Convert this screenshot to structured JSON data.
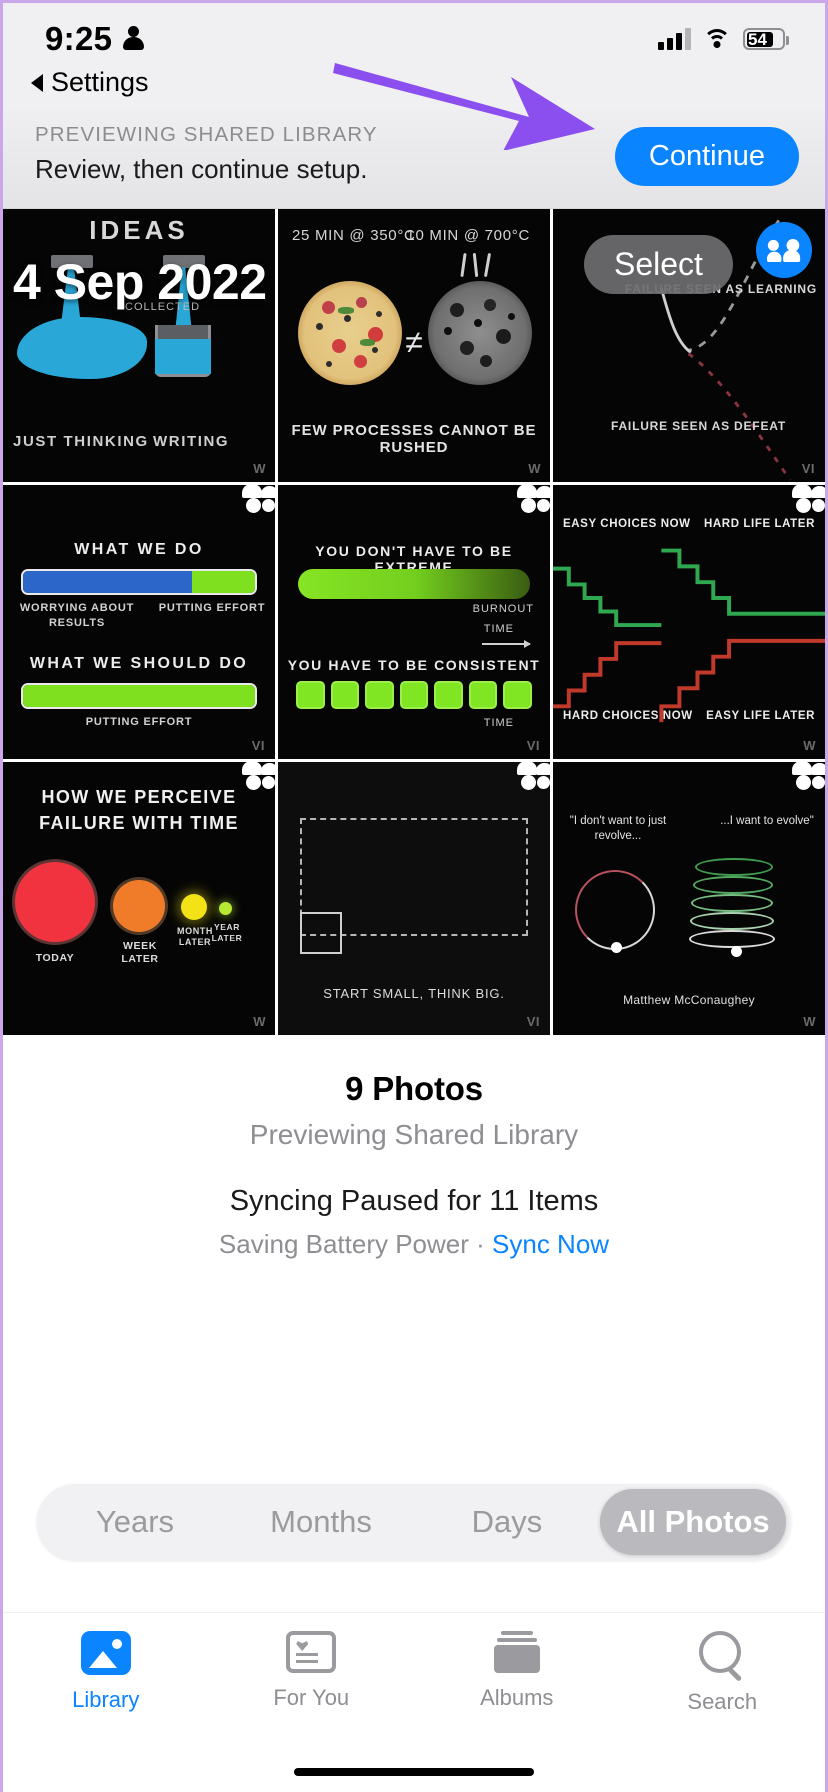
{
  "status_bar": {
    "time": "9:25",
    "person_icon": "person-icon",
    "signal_icon": "cellular-signal-icon",
    "wifi_icon": "wifi-icon",
    "battery_level": "54",
    "battery_icon": "battery-icon"
  },
  "nav": {
    "back_label": "Settings",
    "back_icon": "chevron-left-icon"
  },
  "banner": {
    "kicker": "PREVIEWING SHARED LIBRARY",
    "subtitle": "Review, then continue setup.",
    "continue_label": "Continue",
    "accent_color": "#0a84ff",
    "annotation_arrow_color": "#8b4ff0"
  },
  "grid": {
    "select_label": "Select",
    "date_overlay": "4 Sep 2022",
    "photos": [
      {
        "name": "ideas-thinking-vs-writing",
        "title": "IDEAS",
        "label_left": "JUST THINKING",
        "label_right": "WRITING",
        "annotation": "COLLECTED",
        "watermark": "W",
        "shared": false
      },
      {
        "name": "pizza-processes",
        "label_left": "25 MIN @ 350°C",
        "label_right": "10 MIN @ 700°C",
        "operator": "≠",
        "caption": "FEW PROCESSES CANNOT BE RUSHED",
        "watermark": "W",
        "shared": false
      },
      {
        "name": "failure-seen-as",
        "label_right": "FAILURE SEEN AS LEARNING",
        "label_bottom": "FAILURE SEEN AS DEFEAT",
        "watermark": "VI",
        "shared": true,
        "badge_style": "blue-circle"
      },
      {
        "name": "what-we-do-effort",
        "heading_top": "WHAT WE DO",
        "label_left": "WORRYING ABOUT RESULTS",
        "label_right": "PUTTING EFFORT",
        "heading_bottom": "WHAT WE SHOULD DO",
        "label_bottom": "PUTTING EFFORT",
        "watermark": "VI",
        "shared": true
      },
      {
        "name": "be-consistent-not-extreme",
        "heading_top": "YOU DON'T HAVE TO BE EXTREME",
        "label_burnout": "BURNOUT",
        "label_time": "TIME",
        "heading_bottom": "YOU HAVE TO BE CONSISTENT",
        "label_time2": "TIME",
        "watermark": "VI",
        "shared": true
      },
      {
        "name": "easy-hard-choices",
        "label_tl": "EASY CHOICES NOW",
        "label_tr": "HARD LIFE LATER",
        "label_bl": "HARD CHOICES NOW",
        "label_br": "EASY LIFE LATER",
        "watermark": "W",
        "shared": true
      },
      {
        "name": "perceive-failure-with-time",
        "heading": "HOW WE PERCEIVE FAILURE WITH TIME",
        "labels": [
          "TODAY",
          "WEEK LATER",
          "MONTH LATER",
          "YEAR LATER"
        ],
        "watermark": "W",
        "shared": true
      },
      {
        "name": "start-small-think-big",
        "caption": "START SMALL, THINK BIG.",
        "caption_bold_1": "SMALL",
        "caption_bold_2": "BIG",
        "watermark": "VI",
        "shared": true
      },
      {
        "name": "revolve-vs-evolve",
        "quote_left": "\"I don't want to just revolve...",
        "quote_right": "...I want to evolve\"",
        "attribution": "Matthew McConaughey",
        "watermark": "W",
        "shared": true
      }
    ]
  },
  "info": {
    "photo_count": "9 Photos",
    "subtitle": "Previewing Shared Library",
    "sync_status": "Syncing Paused for 11 Items",
    "battery_reason": "Saving Battery Power · ",
    "sync_now_label": "Sync Now"
  },
  "segmented_control": {
    "items": [
      "Years",
      "Months",
      "Days",
      "All Photos"
    ],
    "selected": "All Photos"
  },
  "tab_bar": {
    "tabs": [
      {
        "label": "Library",
        "icon": "photo-library-icon",
        "active": true
      },
      {
        "label": "For You",
        "icon": "for-you-icon",
        "active": false
      },
      {
        "label": "Albums",
        "icon": "albums-icon",
        "active": false
      },
      {
        "label": "Search",
        "icon": "search-icon",
        "active": false
      }
    ]
  }
}
